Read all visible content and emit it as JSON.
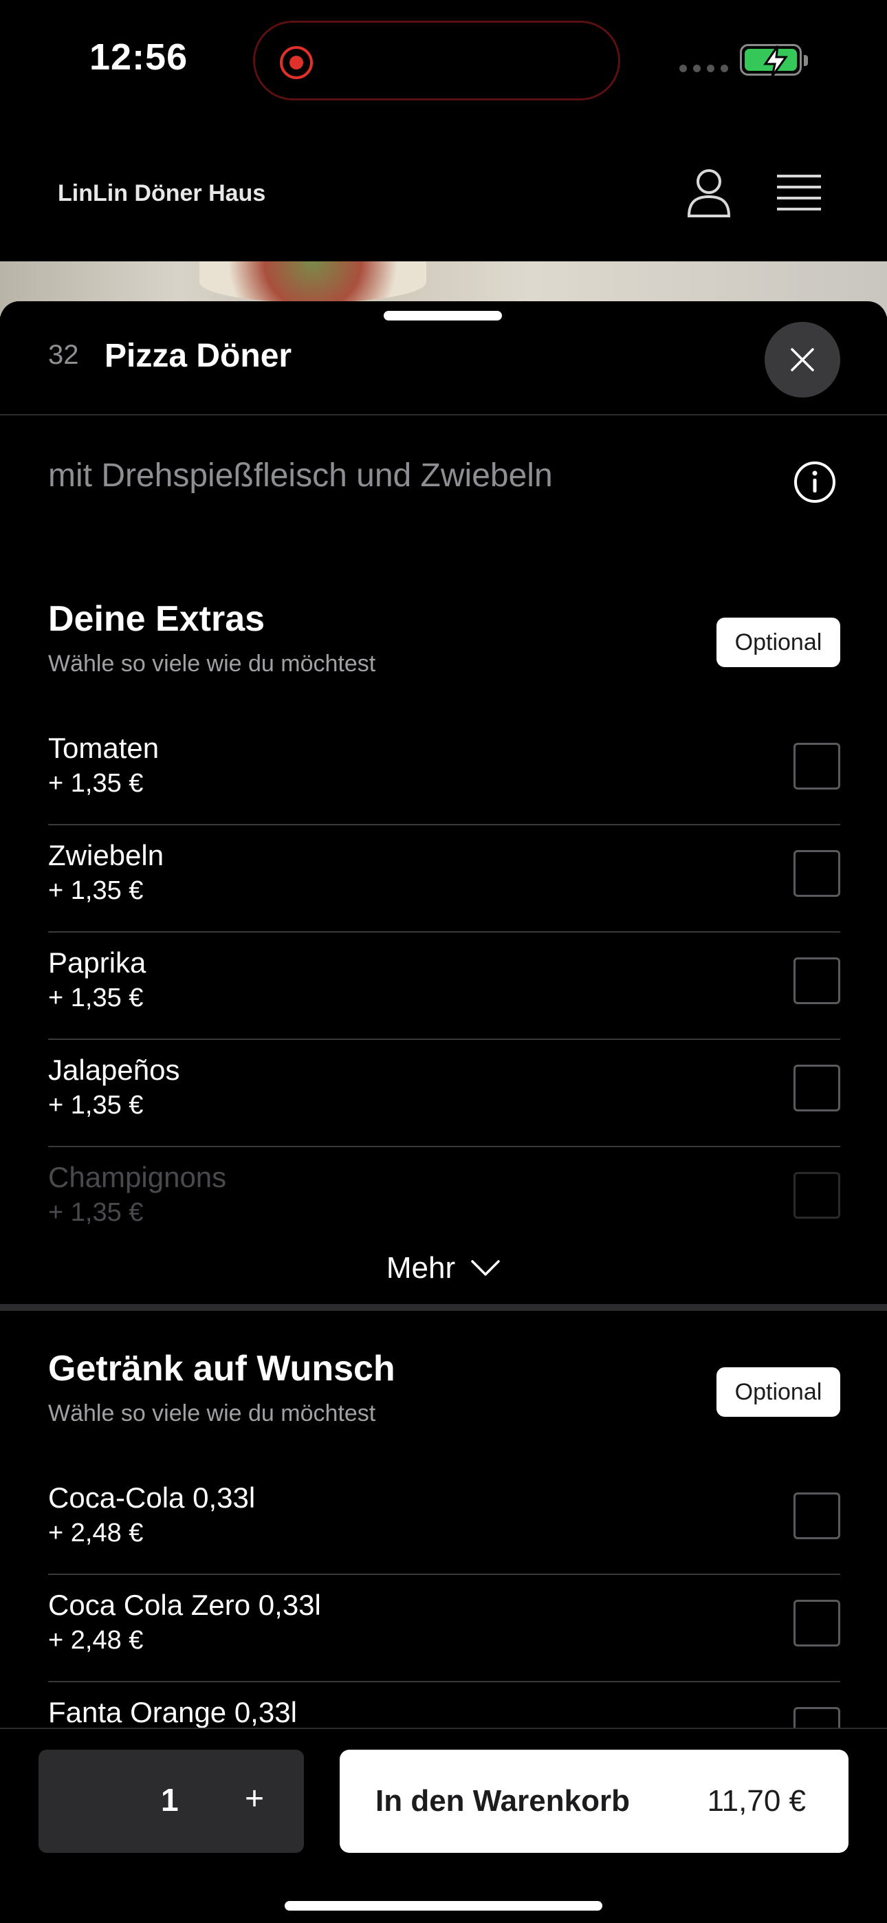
{
  "status_bar": {
    "time": "12:56"
  },
  "header": {
    "brand": "LinLin Döner Haus"
  },
  "item": {
    "number": "32",
    "title": "Pizza Döner",
    "description": "mit Drehspießfleisch und Zwiebeln"
  },
  "extras": {
    "title": "Deine Extras",
    "subtitle": "Wähle so viele wie du möchtest",
    "badge": "Optional",
    "options": [
      {
        "name": "Tomaten",
        "price": "+ 1,35 €"
      },
      {
        "name": "Zwiebeln",
        "price": "+ 1,35 €"
      },
      {
        "name": "Paprika",
        "price": "+ 1,35 €"
      },
      {
        "name": "Jalapeños",
        "price": "+ 1,35 €"
      },
      {
        "name": "Champignons",
        "price": "+ 1,35 €"
      }
    ],
    "more_label": "Mehr"
  },
  "drinks": {
    "title": "Getränk auf Wunsch",
    "subtitle": "Wähle so viele wie du möchtest",
    "badge": "Optional",
    "options": [
      {
        "name": "Coca-Cola 0,33l",
        "price": "+ 2,48 €"
      },
      {
        "name": "Coca Cola Zero 0,33l",
        "price": "+ 2,48 €"
      },
      {
        "name": "Fanta Orange 0,33l",
        "price": ""
      }
    ]
  },
  "bottom_bar": {
    "quantity": "1",
    "plus": "+",
    "cart_label": "In den Warenkorb",
    "cart_price": "11,70 €"
  },
  "colors": {
    "background": "#000000",
    "surface": "#2c2c2e",
    "muted_text": "#8e8e93",
    "battery": "#36c759",
    "record": "#e0302a"
  }
}
